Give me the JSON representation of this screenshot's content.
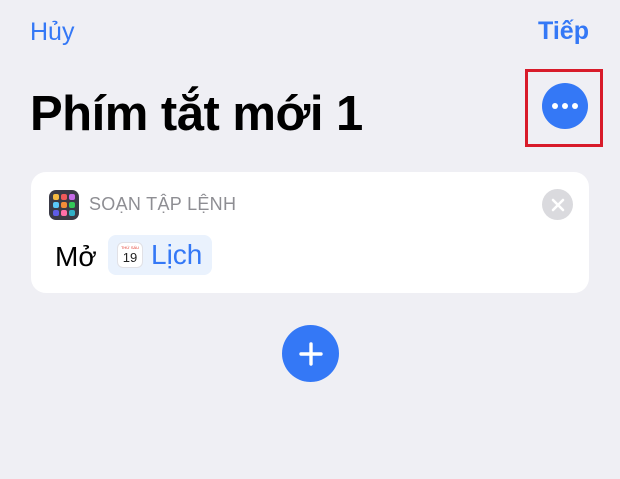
{
  "nav": {
    "cancel_label": "Hủy",
    "next_label": "Tiếp"
  },
  "page": {
    "title": "Phím tắt mới 1"
  },
  "action_card": {
    "category": "SOẠN TẬP LỆNH",
    "verb": "Mở",
    "app": {
      "name": "Lịch",
      "icon_day": "THỨ SÁU",
      "icon_date": "19"
    }
  },
  "icons": {
    "more": "ellipsis-icon",
    "remove": "close-icon",
    "add": "plus-icon",
    "script_app": "scripting-grid-icon",
    "calendar": "calendar-icon"
  },
  "colors": {
    "accent": "#3478f6",
    "background": "#efeff4",
    "card": "#ffffff",
    "highlight": "#d81b2a",
    "secondary_text": "#8e8e93",
    "token_background": "#eaf2fd"
  }
}
